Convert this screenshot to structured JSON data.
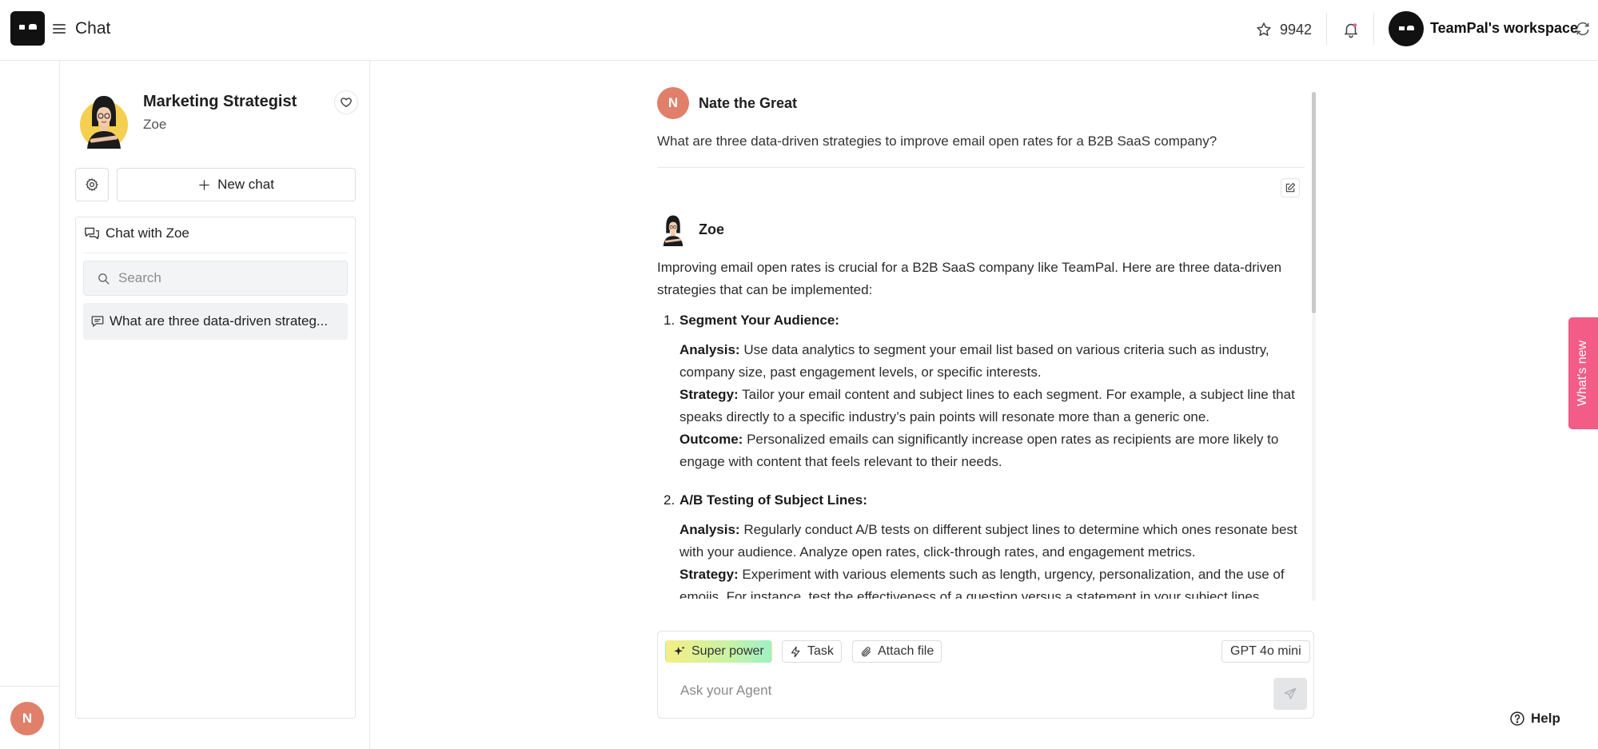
{
  "header": {
    "title": "Chat",
    "star_count": "9942",
    "workspace_name": "TeamPal's workspace"
  },
  "rail": {
    "user_initial": "N"
  },
  "sidebar": {
    "agent_name": "Marketing Strategist",
    "agent_persona": "Zoe",
    "new_chat_label": "New chat",
    "list_title": "Chat with Zoe",
    "search_placeholder": "Search",
    "conversations": [
      "What are three data-driven strateg..."
    ]
  },
  "conversation": {
    "user": {
      "initial": "N",
      "name": "Nate the Great",
      "text": "What are three data-driven strategies to improve email open rates for a B2B SaaS company?"
    },
    "agent": {
      "name": "Zoe",
      "intro": "Improving email open rates is crucial for a B2B SaaS company like TeamPal. Here are three data-driven strategies that can be implemented:",
      "items": [
        {
          "num": "1.",
          "title": "Segment Your Audience:",
          "analysis_label": "Analysis:",
          "analysis": "Use data analytics to segment your email list based on various criteria such as industry, company size, past engagement levels, or specific interests.",
          "strategy_label": "Strategy:",
          "strategy": "Tailor your email content and subject lines to each segment. For example, a subject line that speaks directly to a specific industry’s pain points will resonate more than a generic one.",
          "outcome_label": "Outcome:",
          "outcome": "Personalized emails can significantly increase open rates as recipients are more likely to engage with content that feels relevant to their needs."
        },
        {
          "num": "2.",
          "title": "A/B Testing of Subject Lines:",
          "analysis_label": "Analysis:",
          "analysis": "Regularly conduct A/B tests on different subject lines to determine which ones resonate best with your audience. Analyze open rates, click-through rates, and engagement metrics.",
          "strategy_label": "Strategy:",
          "strategy": "Experiment with various elements such as length, urgency, personalization, and the use of emojis. For instance, test the effectiveness of a question versus a statement in your subject lines."
        }
      ]
    }
  },
  "composer": {
    "superpower_label": "Super power",
    "task_label": "Task",
    "attach_label": "Attach file",
    "model_label": "GPT 4o mini",
    "placeholder": "Ask your Agent"
  },
  "whats_new_label": "What's new",
  "help_label": "Help",
  "colors": {
    "accent_pink": "#f25c87",
    "avatar_orange": "#e0806a"
  }
}
